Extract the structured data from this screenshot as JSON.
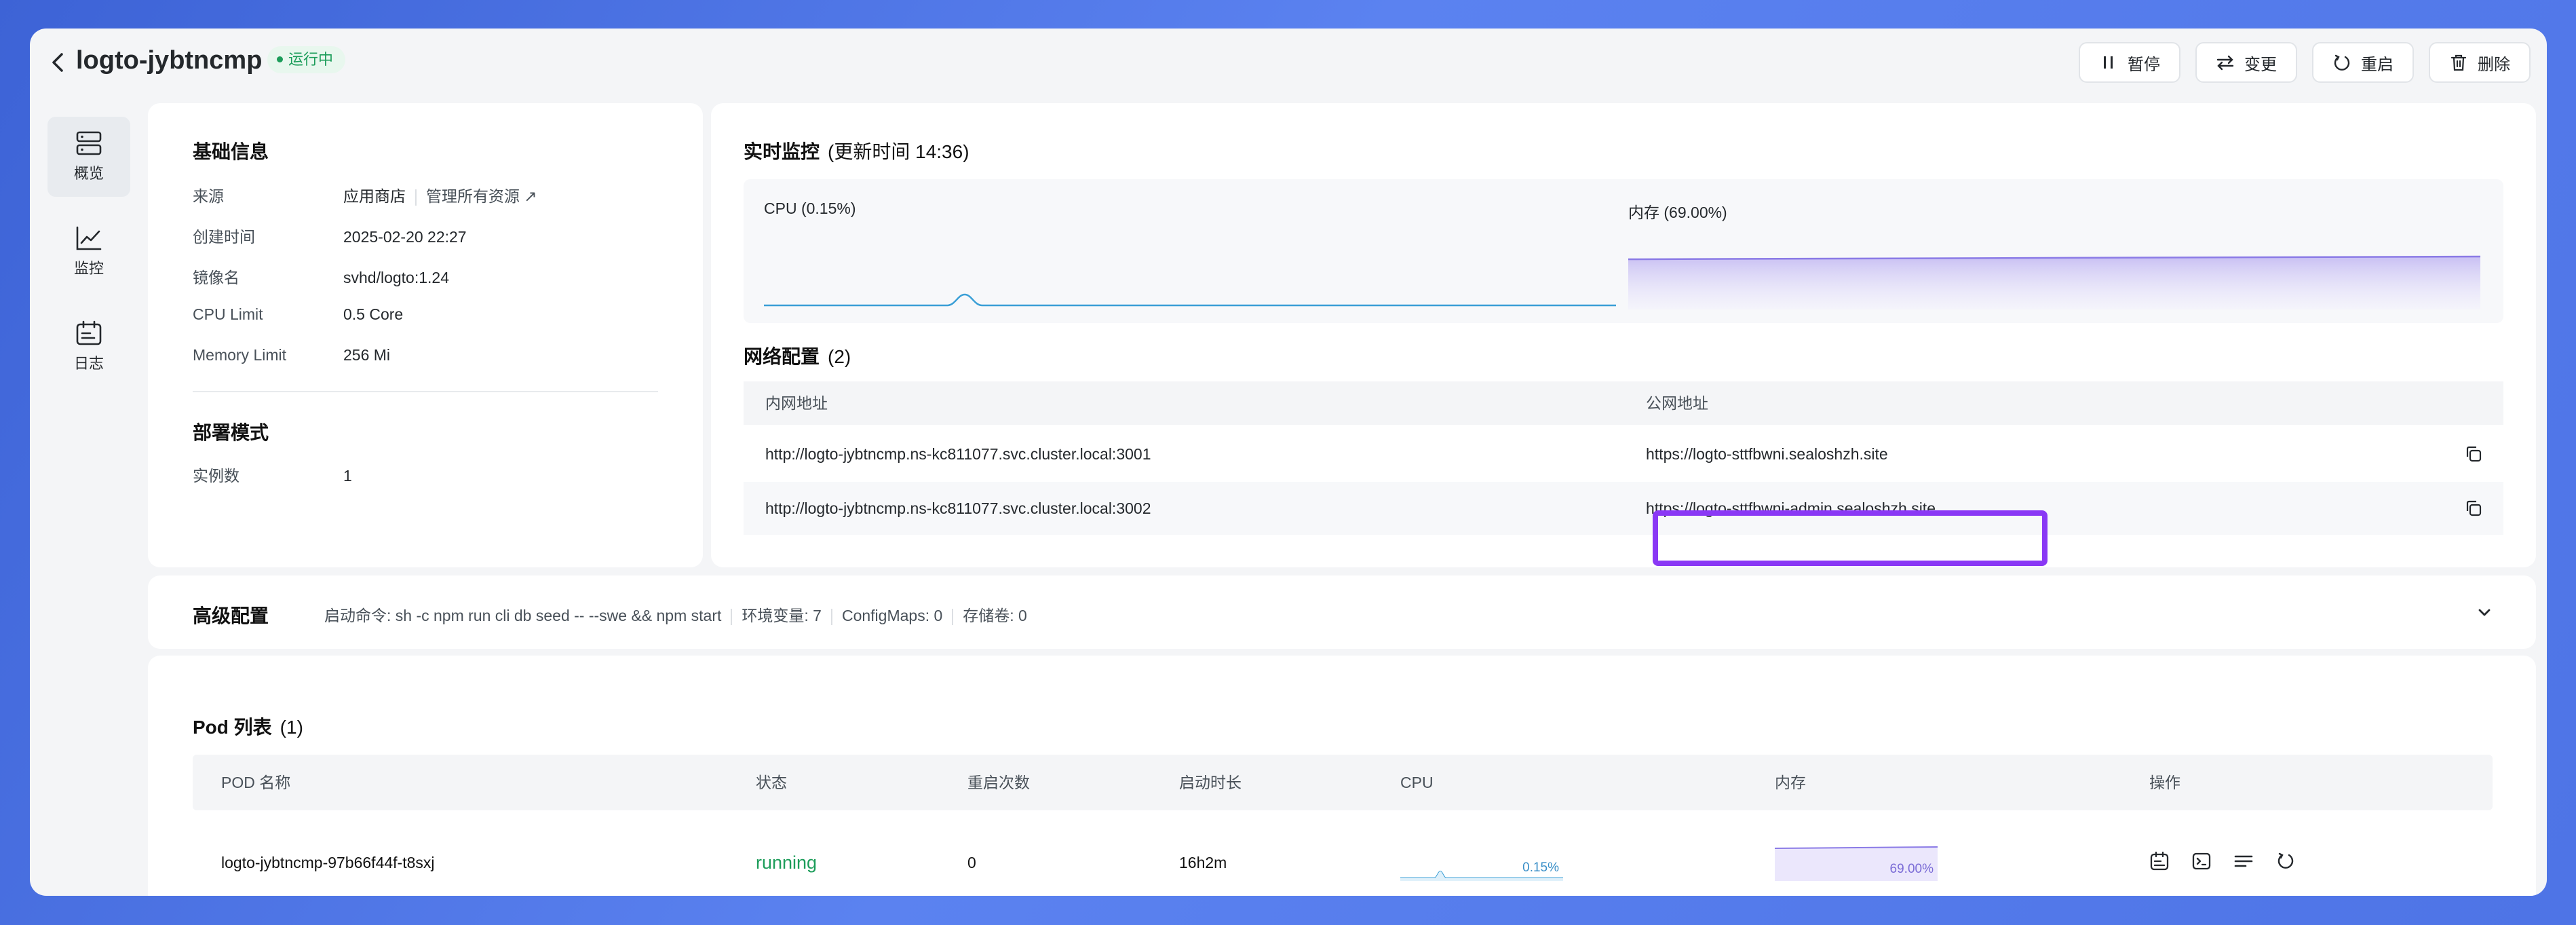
{
  "header": {
    "title": "logto-jybtncmp",
    "status": "运行中",
    "actions": {
      "pause": "暂停",
      "change": "变更",
      "restart": "重启",
      "delete": "删除"
    }
  },
  "sidebar": {
    "items": [
      {
        "label": "概览"
      },
      {
        "label": "监控"
      },
      {
        "label": "日志"
      }
    ]
  },
  "basic": {
    "title": "基础信息",
    "rows": [
      {
        "label": "来源",
        "value": "应用商店",
        "link": "管理所有资源"
      },
      {
        "label": "创建时间",
        "value": "2025-02-20 22:27"
      },
      {
        "label": "镜像名",
        "value": "svhd/logto:1.24"
      },
      {
        "label": "CPU Limit",
        "value": "0.5 Core"
      },
      {
        "label": "Memory Limit",
        "value": "256 Mi"
      }
    ],
    "deploy_title": "部署模式",
    "instances_label": "实例数",
    "instances_value": "1"
  },
  "monitor": {
    "title": "实时监控",
    "updated": "(更新时间  14:36)",
    "cpu_label": "CPU  (0.15%)",
    "mem_label": "内存  (69.00%)",
    "cpu_percent": 0.15,
    "mem_percent": 69.0
  },
  "network": {
    "title": "网络配置",
    "count": "(2)",
    "col_internal": "内网地址",
    "col_public": "公网地址",
    "rows": [
      {
        "internal": "http://logto-jybtncmp.ns-kc811077.svc.cluster.local:3001",
        "public": "https://logto-sttfbwni.sealoshzh.site"
      },
      {
        "internal": "http://logto-jybtncmp.ns-kc811077.svc.cluster.local:3002",
        "public": "https://logto-sttfbwni-admin.sealoshzh.site"
      }
    ]
  },
  "advanced": {
    "title": "高级配置",
    "command": "启动命令: sh -c npm run cli db seed -- --swe && npm start",
    "env": "环境变量: 7",
    "configmaps": "ConfigMaps: 0",
    "volumes": "存储卷: 0"
  },
  "pods": {
    "title": "Pod 列表",
    "count": "(1)",
    "columns": [
      "POD 名称",
      "状态",
      "重启次数",
      "启动时长",
      "CPU",
      "内存",
      "操作"
    ],
    "rows": [
      {
        "name": "logto-jybtncmp-97b66f44f-t8sxj",
        "status": "running",
        "restarts": "0",
        "uptime": "16h2m",
        "cpu": "0.15%",
        "mem": "69.00%"
      }
    ]
  },
  "colors": {
    "accent": "#8a38f5",
    "running": "#1c9d5a",
    "cpu_line": "#3a9fd6",
    "mem_line": "#8b7be6"
  }
}
